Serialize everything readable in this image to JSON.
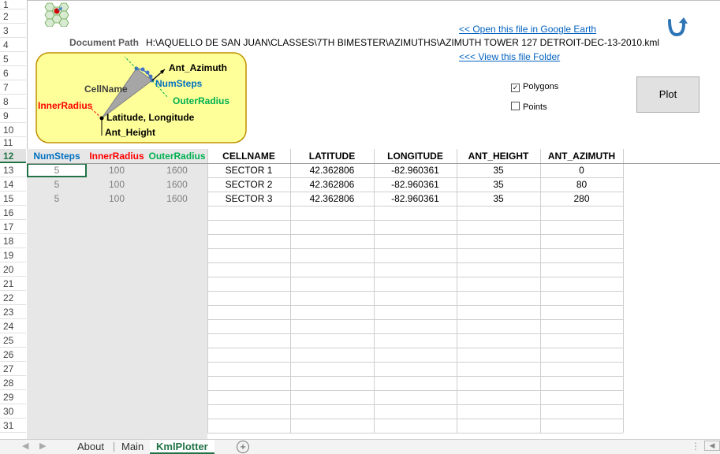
{
  "header": {
    "doc_path_label": "Document Path",
    "doc_path_value": "H:\\AQUELLO DE SAN JUAN\\CLASSES\\7TH BIMESTER\\AZIMUTHS\\AZIMUTH TOWER 127 DETROIT-DEC-13-2010.kml",
    "open_google_earth": "<< Open this file in Google Earth",
    "view_folder": "<<< View this file Folder"
  },
  "options": {
    "polygons_label": "Polygons",
    "polygons_checked": true,
    "points_label": "Points",
    "points_checked": false,
    "plot_button": "Plot"
  },
  "diagram": {
    "ant_azimuth": "Ant_Azimuth",
    "num_steps": "NumSteps",
    "cell_name": "CellName",
    "outer_radius": "OuterRadius",
    "inner_radius": "InnerRadius",
    "lat_lon": "Latitude, Longitude",
    "ant_height": "Ant_Height"
  },
  "row_numbers": [
    "1",
    "2",
    "3",
    "4",
    "5",
    "6",
    "7",
    "8",
    "9",
    "10",
    "11",
    "12",
    "13",
    "14",
    "15",
    "16",
    "17",
    "18",
    "19",
    "20",
    "21",
    "22",
    "23",
    "24",
    "25",
    "26",
    "27",
    "28",
    "29",
    "30",
    "31"
  ],
  "active_row": "12",
  "table": {
    "left_headers": [
      {
        "label": "NumSteps",
        "color": "#0070c0"
      },
      {
        "label": "InnerRadius",
        "color": "#ff0000"
      },
      {
        "label": "OuterRadius",
        "color": "#00b050"
      }
    ],
    "right_headers": [
      "CELLNAME",
      "LATITUDE",
      "LONGITUDE",
      "ANT_HEIGHT",
      "ANT_AZIMUTH"
    ],
    "rows": [
      {
        "num_steps": "5",
        "inner_radius": "100",
        "outer_radius": "1600",
        "cellname": "SECTOR 1",
        "latitude": "42.362806",
        "longitude": "-82.960361",
        "ant_height": "35",
        "ant_azimuth": "0"
      },
      {
        "num_steps": "5",
        "inner_radius": "100",
        "outer_radius": "1600",
        "cellname": "SECTOR 2",
        "latitude": "42.362806",
        "longitude": "-82.960361",
        "ant_height": "35",
        "ant_azimuth": "80"
      },
      {
        "num_steps": "5",
        "inner_radius": "100",
        "outer_radius": "1600",
        "cellname": "SECTOR 3",
        "latitude": "42.362806",
        "longitude": "-82.960361",
        "ant_height": "35",
        "ant_azimuth": "280"
      }
    ]
  },
  "tabs": {
    "items": [
      "About",
      "Main",
      "KmlPlotter"
    ],
    "active": "KmlPlotter",
    "add_symbol": "+"
  },
  "colors": {
    "accent_green": "#217346",
    "link_blue": "#0563c1",
    "diagram_fill": "#ffff99",
    "diagram_border": "#bf9000"
  }
}
